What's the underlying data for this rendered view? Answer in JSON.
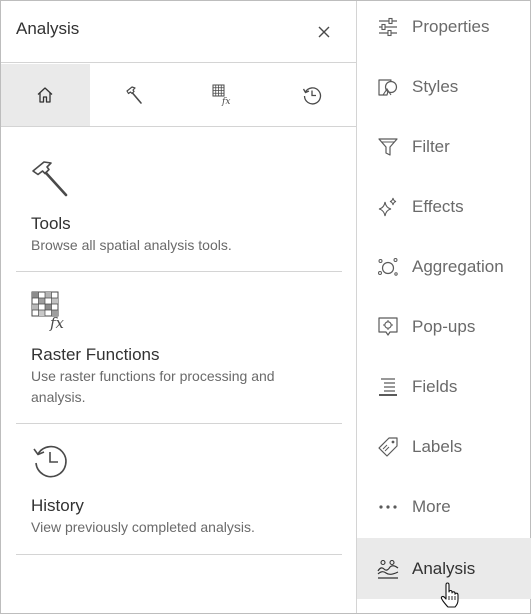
{
  "panel": {
    "title": "Analysis",
    "tabs": [
      {
        "icon": "home-icon",
        "active": true
      },
      {
        "icon": "hammer-icon",
        "active": false
      },
      {
        "icon": "raster-function-icon",
        "active": false
      },
      {
        "icon": "history-icon",
        "active": false
      }
    ],
    "cards": [
      {
        "icon": "hammer-icon",
        "title": "Tools",
        "description": "Browse all spatial analysis tools."
      },
      {
        "icon": "raster-function-icon",
        "title": "Raster Functions",
        "description": "Use raster functions for processing and analysis."
      },
      {
        "icon": "history-icon",
        "title": "History",
        "description": "View previously completed analysis."
      }
    ],
    "raster_icon_text": "fx"
  },
  "actionbar": {
    "items": [
      {
        "icon": "sliders-icon",
        "label": "Properties"
      },
      {
        "icon": "styles-icon",
        "label": "Styles"
      },
      {
        "icon": "filter-icon",
        "label": "Filter"
      },
      {
        "icon": "sparkles-icon",
        "label": "Effects"
      },
      {
        "icon": "aggregation-icon",
        "label": "Aggregation"
      },
      {
        "icon": "popup-icon",
        "label": "Pop-ups"
      },
      {
        "icon": "fields-icon",
        "label": "Fields"
      },
      {
        "icon": "label-tag-icon",
        "label": "Labels"
      },
      {
        "icon": "more-icon",
        "label": "More"
      },
      {
        "icon": "analysis-icon",
        "label": "Analysis",
        "active": true
      }
    ]
  },
  "colors": {
    "text": "#323232",
    "muted": "#6a6a6a",
    "active_bg": "#eaeaea",
    "divider": "#d4d4d4"
  }
}
